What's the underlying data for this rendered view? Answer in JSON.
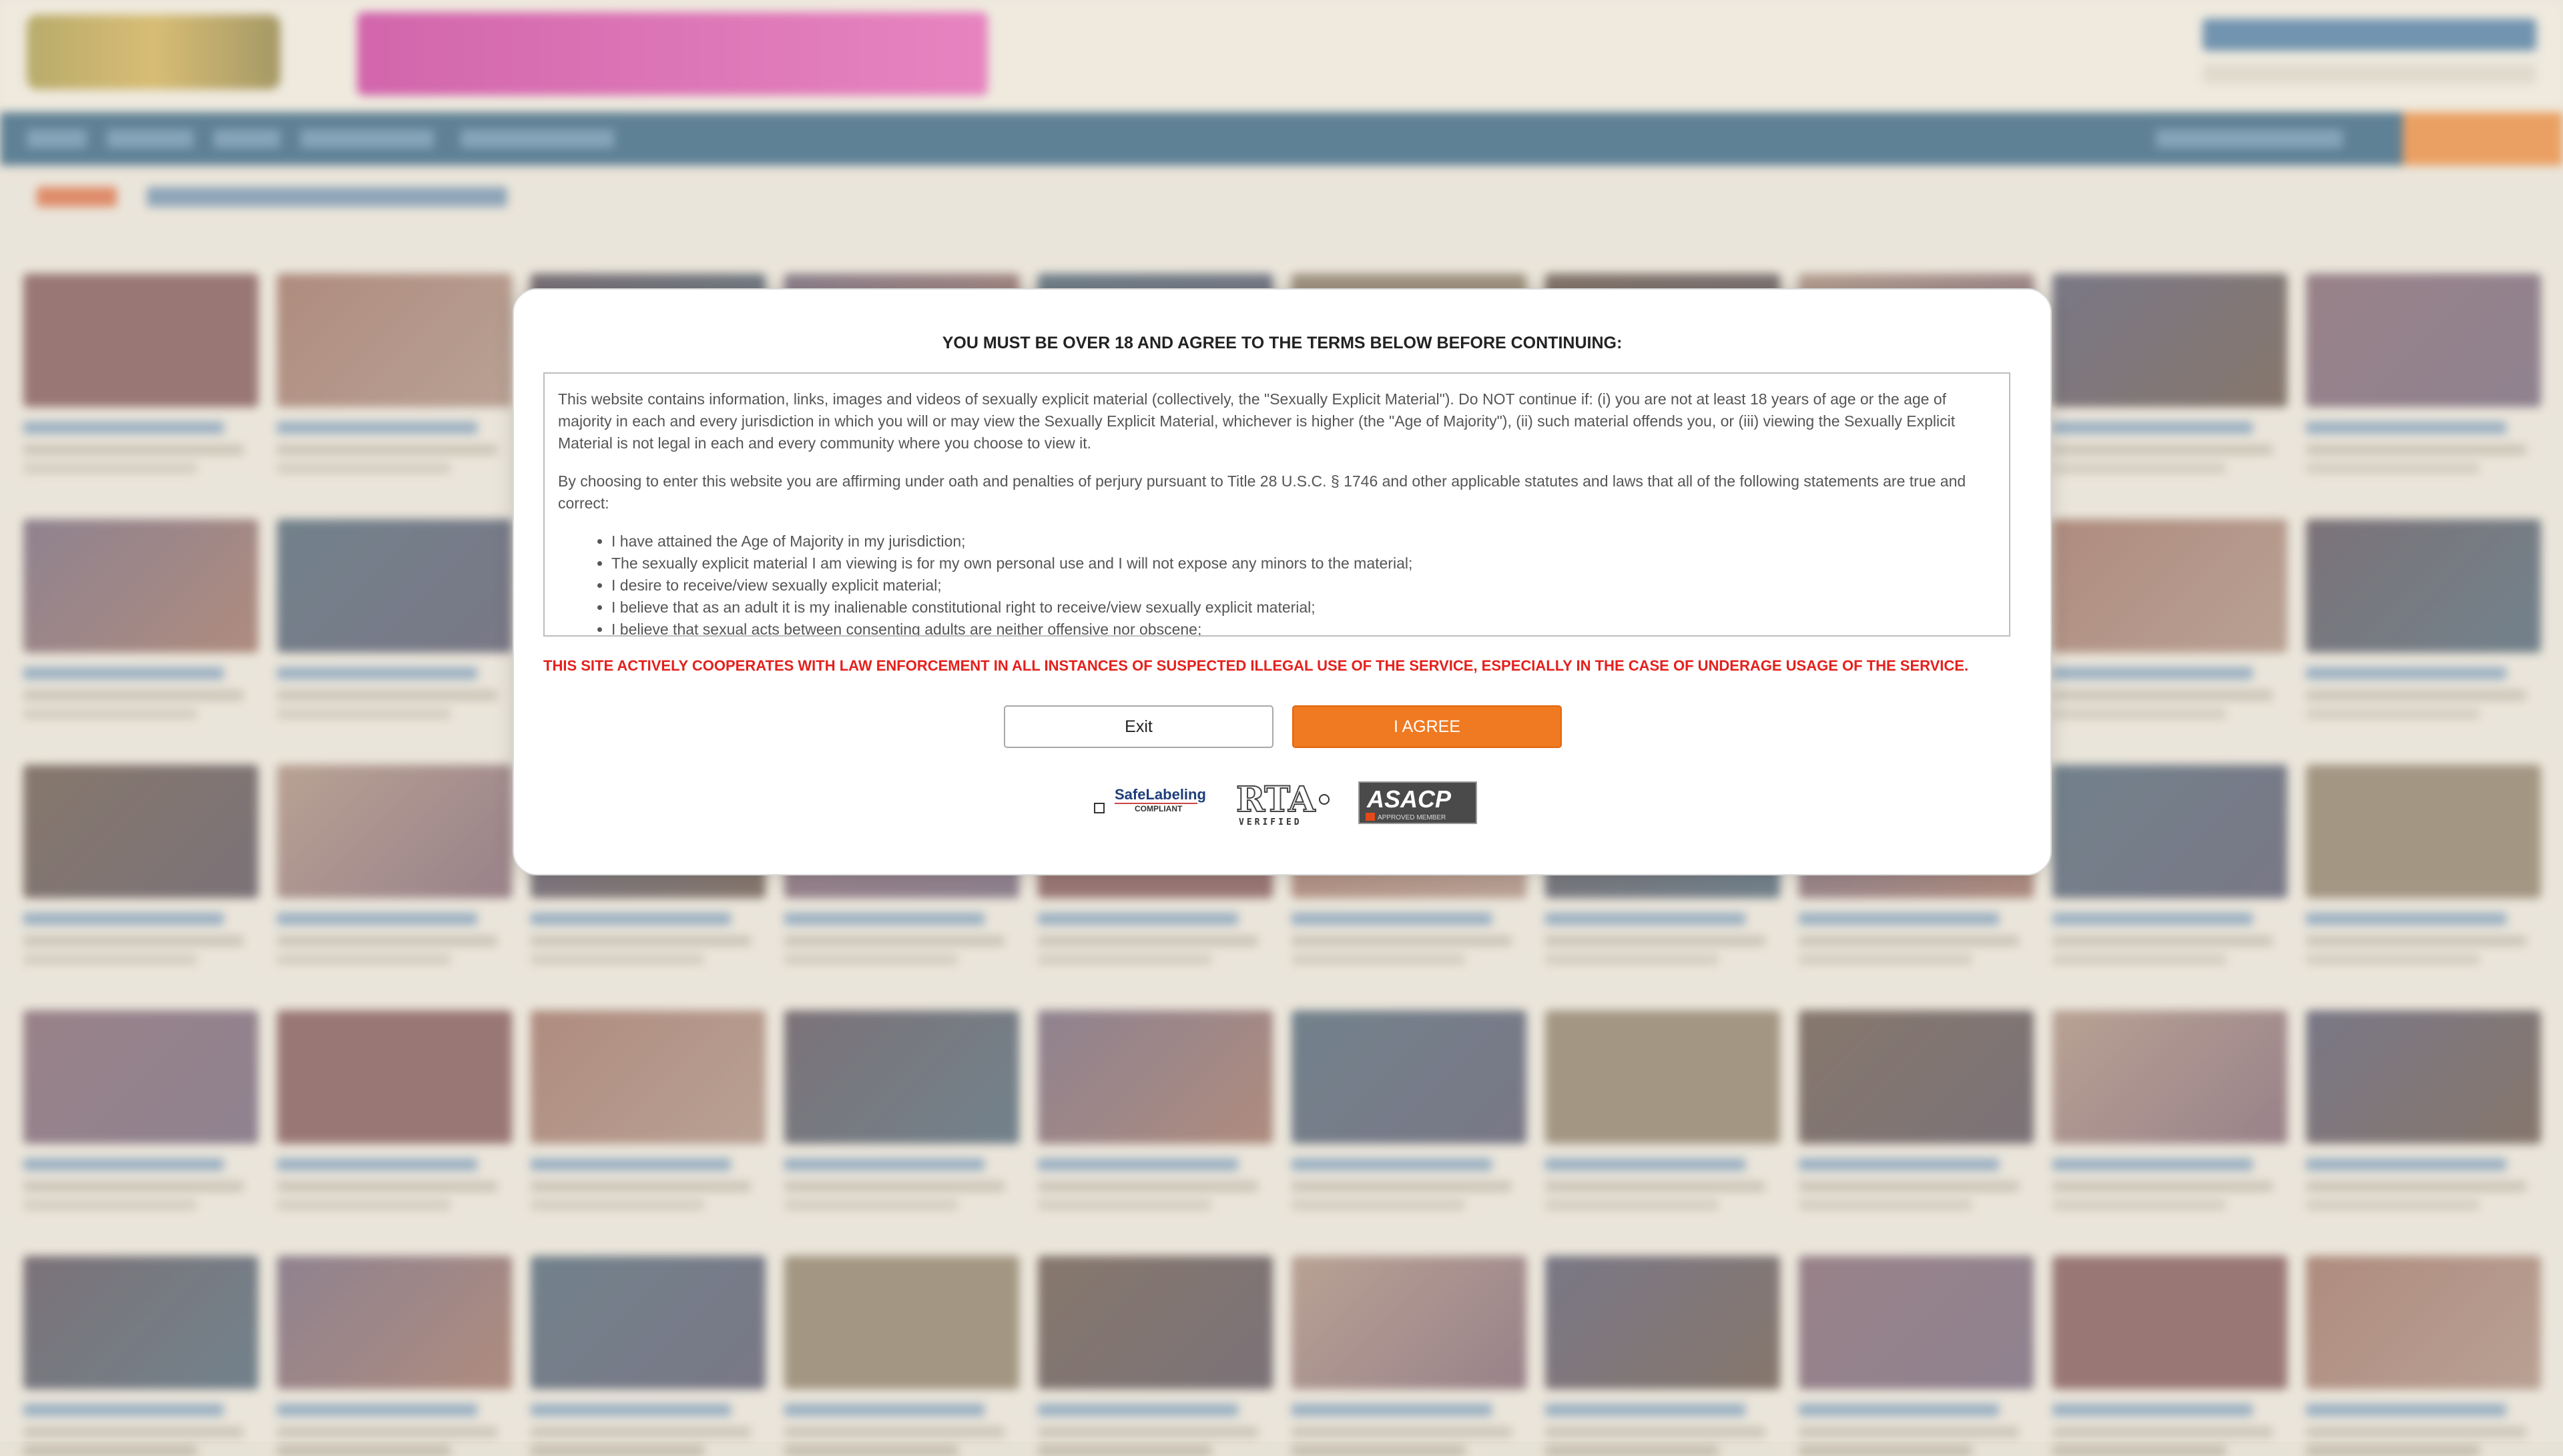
{
  "modal": {
    "title": "YOU MUST BE OVER 18 AND AGREE TO THE TERMS BELOW BEFORE CONTINUING:",
    "paragraphs": [
      "This website contains information, links, images and videos of sexually explicit material (collectively, the \"Sexually Explicit Material\"). Do NOT continue if: (i) you are not at least 18 years of age or the age of majority in each and every jurisdiction in which you will or may view the Sexually Explicit Material, whichever is higher (the \"Age of Majority\"), (ii) such material offends you, or (iii) viewing the Sexually Explicit Material is not legal in each and every community where you choose to view it.",
      "By choosing to enter this website you are affirming under oath and penalties of perjury pursuant to Title 28 U.S.C. § 1746 and other applicable statutes and laws that all of the following statements are true and correct:"
    ],
    "statements": [
      "I have attained the Age of Majority in my jurisdiction;",
      "The sexually explicit material I am viewing is for my own personal use and I will not expose any minors to the material;",
      "I desire to receive/view sexually explicit material;",
      "I believe that as an adult it is my inalienable constitutional right to receive/view sexually explicit material;",
      "I believe that sexual acts between consenting adults are neither offensive nor obscene;"
    ],
    "warning": "THIS SITE ACTIVELY COOPERATES WITH LAW ENFORCEMENT IN ALL INSTANCES OF SUSPECTED ILLEGAL USE OF THE SERVICE, ESPECIALLY IN THE CASE OF UNDERAGE USAGE OF THE SERVICE.",
    "exit_label": "Exit",
    "agree_label": "I AGREE",
    "badges": {
      "safelabeling_top": "SafeLabeling",
      "safelabeling_bottom": "COMPLIANT",
      "rta_top": "RTA",
      "rta_bottom": "VERIFIED",
      "asacp_top": "ASACP",
      "asacp_bottom": "APPROVED MEMBER"
    }
  },
  "colors": {
    "accent": "#f07a22",
    "warning": "#e4201c",
    "nav": "#12496d"
  }
}
